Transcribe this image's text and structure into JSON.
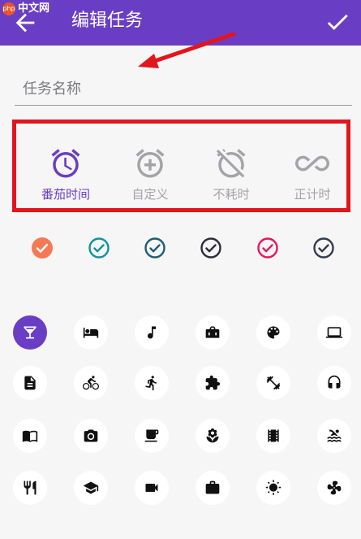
{
  "appbar": {
    "title": "编辑任务",
    "back_icon": "arrow-left-icon",
    "confirm_icon": "check-icon",
    "watermark": "中文网",
    "watermark_badge": "php"
  },
  "task_name": {
    "placeholder": "任务名称",
    "value": ""
  },
  "timer_modes": [
    {
      "label": "番茄时间",
      "icon": "alarm-clock-icon",
      "selected": true
    },
    {
      "label": "自定义",
      "icon": "alarm-add-icon",
      "selected": false
    },
    {
      "label": "不耗时",
      "icon": "alarm-off-icon",
      "selected": false
    },
    {
      "label": "正计时",
      "icon": "infinity-icon",
      "selected": false
    }
  ],
  "colors": [
    {
      "hex": "#f47a55",
      "selected": true
    },
    {
      "hex": "#13939a",
      "selected": false
    },
    {
      "hex": "#1f5f6f",
      "selected": false
    },
    {
      "hex": "#2e2e36",
      "selected": false
    },
    {
      "hex": "#e8175d",
      "selected": false
    },
    {
      "hex": "#353b52",
      "selected": false
    }
  ],
  "accent_color": "#6a3ec4",
  "annotation_color": "#e3151c",
  "task_icons": [
    "cocktail-icon",
    "bed-icon",
    "music-note-icon",
    "briefcase-icon",
    "palette-icon",
    "laptop-icon",
    "document-icon",
    "bike-icon",
    "run-icon",
    "puzzle-icon",
    "dumbbell-icon",
    "headphones-icon",
    "book-icon",
    "camera-icon",
    "coffee-icon",
    "flower-icon",
    "film-icon",
    "swimming-icon",
    "restaurant-icon",
    "graduation-cap-icon",
    "videocam-icon",
    "work-bag-icon",
    "sun-icon",
    "pinwheel-icon"
  ],
  "selected_icon_index": 0
}
